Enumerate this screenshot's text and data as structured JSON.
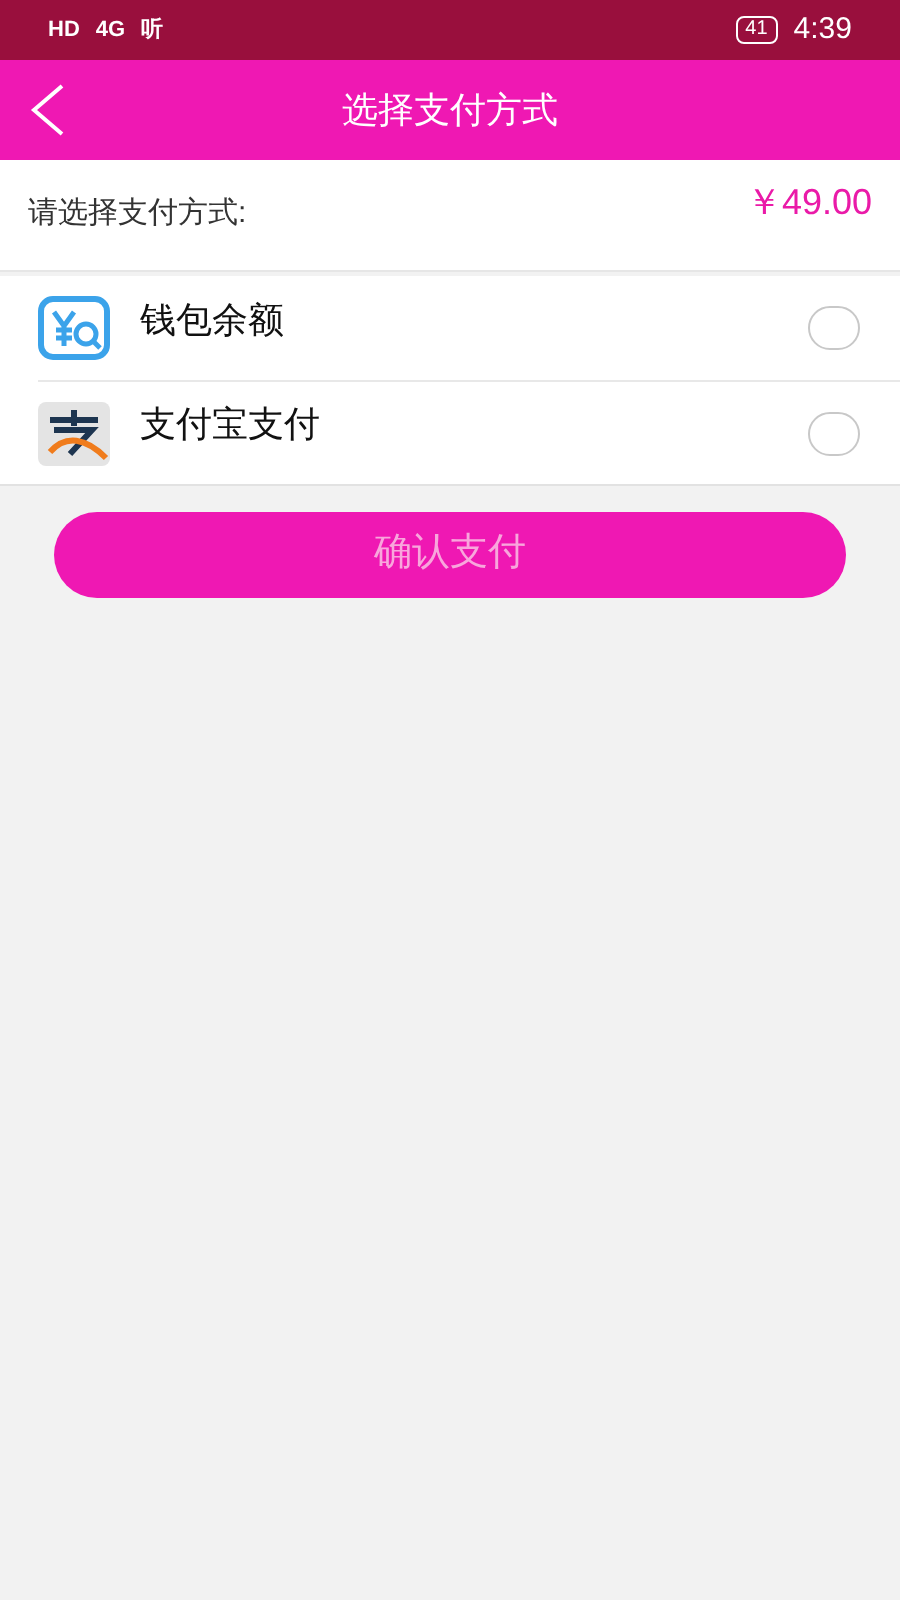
{
  "status_bar": {
    "left": [
      "HD",
      "4G",
      "听"
    ],
    "battery": "41",
    "time": "4:39"
  },
  "header": {
    "title": "选择支付方式"
  },
  "summary": {
    "label": "请选择支付方式:",
    "amount": "￥49.00"
  },
  "methods": [
    {
      "kind": "wallet",
      "label": "钱包余额",
      "selected": false
    },
    {
      "kind": "alipay",
      "label": "支付宝支付",
      "selected": false
    }
  ],
  "confirm": {
    "label": "确认支付",
    "disabled": true
  }
}
